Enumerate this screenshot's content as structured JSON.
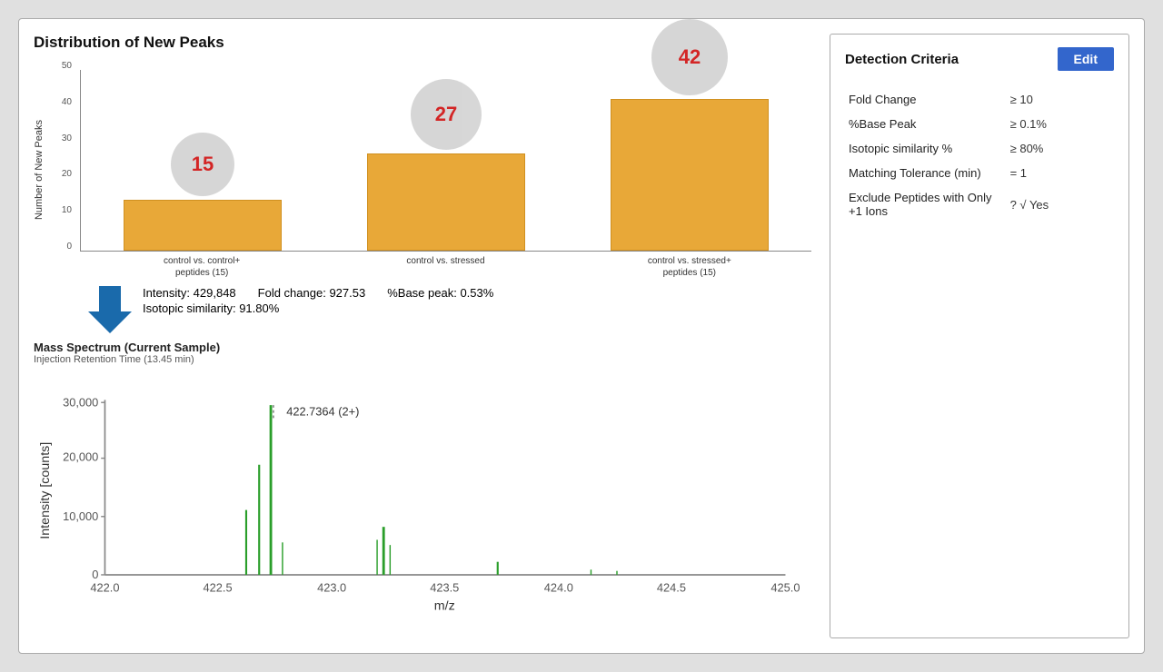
{
  "title": "Distribution of New Peaks",
  "chart": {
    "y_axis_label": "Number of New Peaks",
    "y_ticks": [
      "0",
      "10",
      "20",
      "30",
      "40",
      "50"
    ],
    "bars": [
      {
        "value": 15,
        "height_pct": 28,
        "label": "control vs. control+\npeptides (15)",
        "bubble_value": "15"
      },
      {
        "value": 27,
        "height_pct": 54,
        "label": "control vs. stressed",
        "bubble_value": "27"
      },
      {
        "value": 42,
        "height_pct": 84,
        "label": "control vs. stressed+\npeptides (15)",
        "bubble_value": "42"
      }
    ]
  },
  "stats": {
    "intensity_label": "Intensity:",
    "intensity_value": "429,848",
    "fold_change_label": "Fold change:",
    "fold_change_value": "927.53",
    "base_peak_label": "%Base peak:",
    "base_peak_value": "0.53%",
    "isotopic_label": "Isotopic similarity:",
    "isotopic_value": "91.80%"
  },
  "spectrum": {
    "title": "Mass Spectrum (Current Sample)",
    "subtitle": "Injection Retention Time (13.45 min)",
    "peak_label": "422.7364 (2+)",
    "x_min": 422.0,
    "x_max": 425.0,
    "y_max": 30000,
    "x_ticks": [
      "422.0",
      "422.5",
      "423.0",
      "423.5",
      "424.0",
      "424.5",
      "425.0"
    ],
    "y_ticks": [
      "0",
      "10,000",
      "20,000",
      "30,000"
    ],
    "x_axis_label": "m/z",
    "y_axis_label": "Intensity [counts]"
  },
  "criteria": {
    "title": "Detection Criteria",
    "edit_label": "Edit",
    "rows": [
      {
        "name": "Fold Change",
        "value": "≥ 10"
      },
      {
        "name": "%Base Peak",
        "value": "≥ 0.1%"
      },
      {
        "name": "Isotopic similarity %",
        "value": "≥ 80%"
      },
      {
        "name": "Matching Tolerance (min)",
        "value": "= 1"
      },
      {
        "name": "Exclude Peptides with Only +1 Ions",
        "value": "? √ Yes"
      }
    ]
  }
}
